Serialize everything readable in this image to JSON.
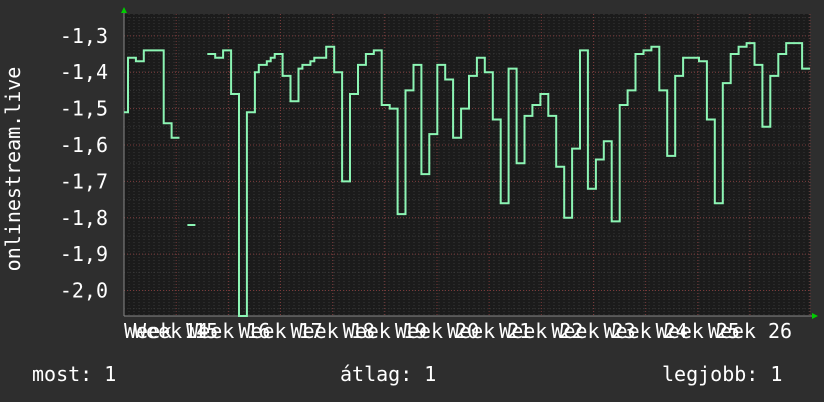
{
  "colors": {
    "background": "#2e2e2e",
    "plot_background": "#1b1b1b",
    "line": "#8cf5b4",
    "grid_major": "#7a3a3a",
    "grid_minor": "#4a4a4a",
    "axis_arrow": "#00cc00",
    "text": "#ffffff"
  },
  "chart_data": {
    "type": "line",
    "ylabel": "onlinestream.live",
    "ylim": [
      -2.07,
      -1.24
    ],
    "yticks": [
      -1.3,
      -1.4,
      -1.5,
      -1.6,
      -1.7,
      -1.8,
      -1.9,
      -2.0
    ],
    "ytick_labels": [
      "-1,3",
      "-1,4",
      "-1,5",
      "-1,6",
      "-1,7",
      "-1,8",
      "-1,9",
      "-2,0"
    ],
    "xlim": [
      0,
      96
    ],
    "xticks": [
      0,
      7.3,
      14.6,
      21.9,
      29.2,
      36.5,
      43.8,
      51.1,
      58.4,
      65.7,
      73,
      80.3,
      87.6,
      96
    ],
    "xtick_labels": [
      "Week 14",
      "Week 15",
      "Week 16",
      "Week 17",
      "Week 18",
      "Week 19",
      "Week 20",
      "Week 21",
      "Week 22",
      "Week 23",
      "Week 24",
      "Week 25",
      "Week 26",
      ""
    ],
    "grid": true,
    "series": [
      {
        "values": [
          -1.51,
          -1.36,
          -1.36,
          -1.37,
          -1.37,
          -1.34,
          -1.34,
          -1.34,
          -1.34,
          -1.34,
          -1.54,
          -1.54,
          -1.58,
          -1.58,
          null,
          null,
          -1.82,
          -1.82,
          null,
          null,
          null,
          -1.35,
          -1.35,
          -1.36,
          -1.36,
          -1.34,
          -1.34,
          -1.46,
          -1.46,
          -2.07,
          -2.07,
          -1.51,
          -1.51,
          -1.4,
          -1.38,
          -1.38,
          -1.37,
          -1.36,
          -1.35,
          -1.35,
          -1.41,
          -1.41,
          -1.48,
          -1.48,
          -1.39,
          -1.38,
          -1.38,
          -1.37,
          -1.36,
          -1.36,
          -1.36,
          -1.33,
          -1.33,
          -1.4,
          -1.4,
          -1.7,
          -1.7,
          -1.46,
          -1.46,
          -1.38,
          -1.38,
          -1.35,
          -1.35,
          -1.34,
          -1.34,
          -1.49,
          -1.49,
          -1.5,
          -1.5,
          -1.79,
          -1.79,
          -1.45,
          -1.45,
          -1.38,
          -1.38,
          -1.68,
          -1.68,
          -1.57,
          -1.57,
          -1.38,
          -1.38,
          -1.42,
          -1.42,
          -1.58,
          -1.58,
          -1.5,
          -1.5,
          -1.41,
          -1.41,
          -1.36,
          -1.36,
          -1.4,
          -1.4,
          -1.53,
          -1.53,
          -1.76,
          -1.76,
          -1.39,
          -1.39,
          -1.65,
          -1.65,
          -1.52,
          -1.52,
          -1.49,
          -1.49,
          -1.46,
          -1.46,
          -1.52,
          -1.52,
          -1.66,
          -1.66,
          -1.8,
          -1.8,
          -1.61,
          -1.61,
          -1.34,
          -1.34,
          -1.72,
          -1.72,
          -1.64,
          -1.64,
          -1.59,
          -1.59,
          -1.81,
          -1.81,
          -1.49,
          -1.49,
          -1.45,
          -1.45,
          -1.35,
          -1.35,
          -1.34,
          -1.34,
          -1.33,
          -1.33,
          -1.45,
          -1.45,
          -1.63,
          -1.63,
          -1.41,
          -1.41,
          -1.36,
          -1.36,
          -1.36,
          -1.36,
          -1.37,
          -1.37,
          -1.53,
          -1.53,
          -1.76,
          -1.76,
          -1.43,
          -1.43,
          -1.35,
          -1.35,
          -1.33,
          -1.33,
          -1.32,
          -1.32,
          -1.38,
          -1.38,
          -1.55,
          -1.55,
          -1.41,
          -1.41,
          -1.35,
          -1.35,
          -1.32,
          -1.32,
          -1.32,
          -1.32,
          -1.39,
          -1.39
        ]
      }
    ]
  },
  "stats": {
    "now": "most: 1",
    "average": "átlag: 1",
    "best": "legjobb: 1"
  }
}
